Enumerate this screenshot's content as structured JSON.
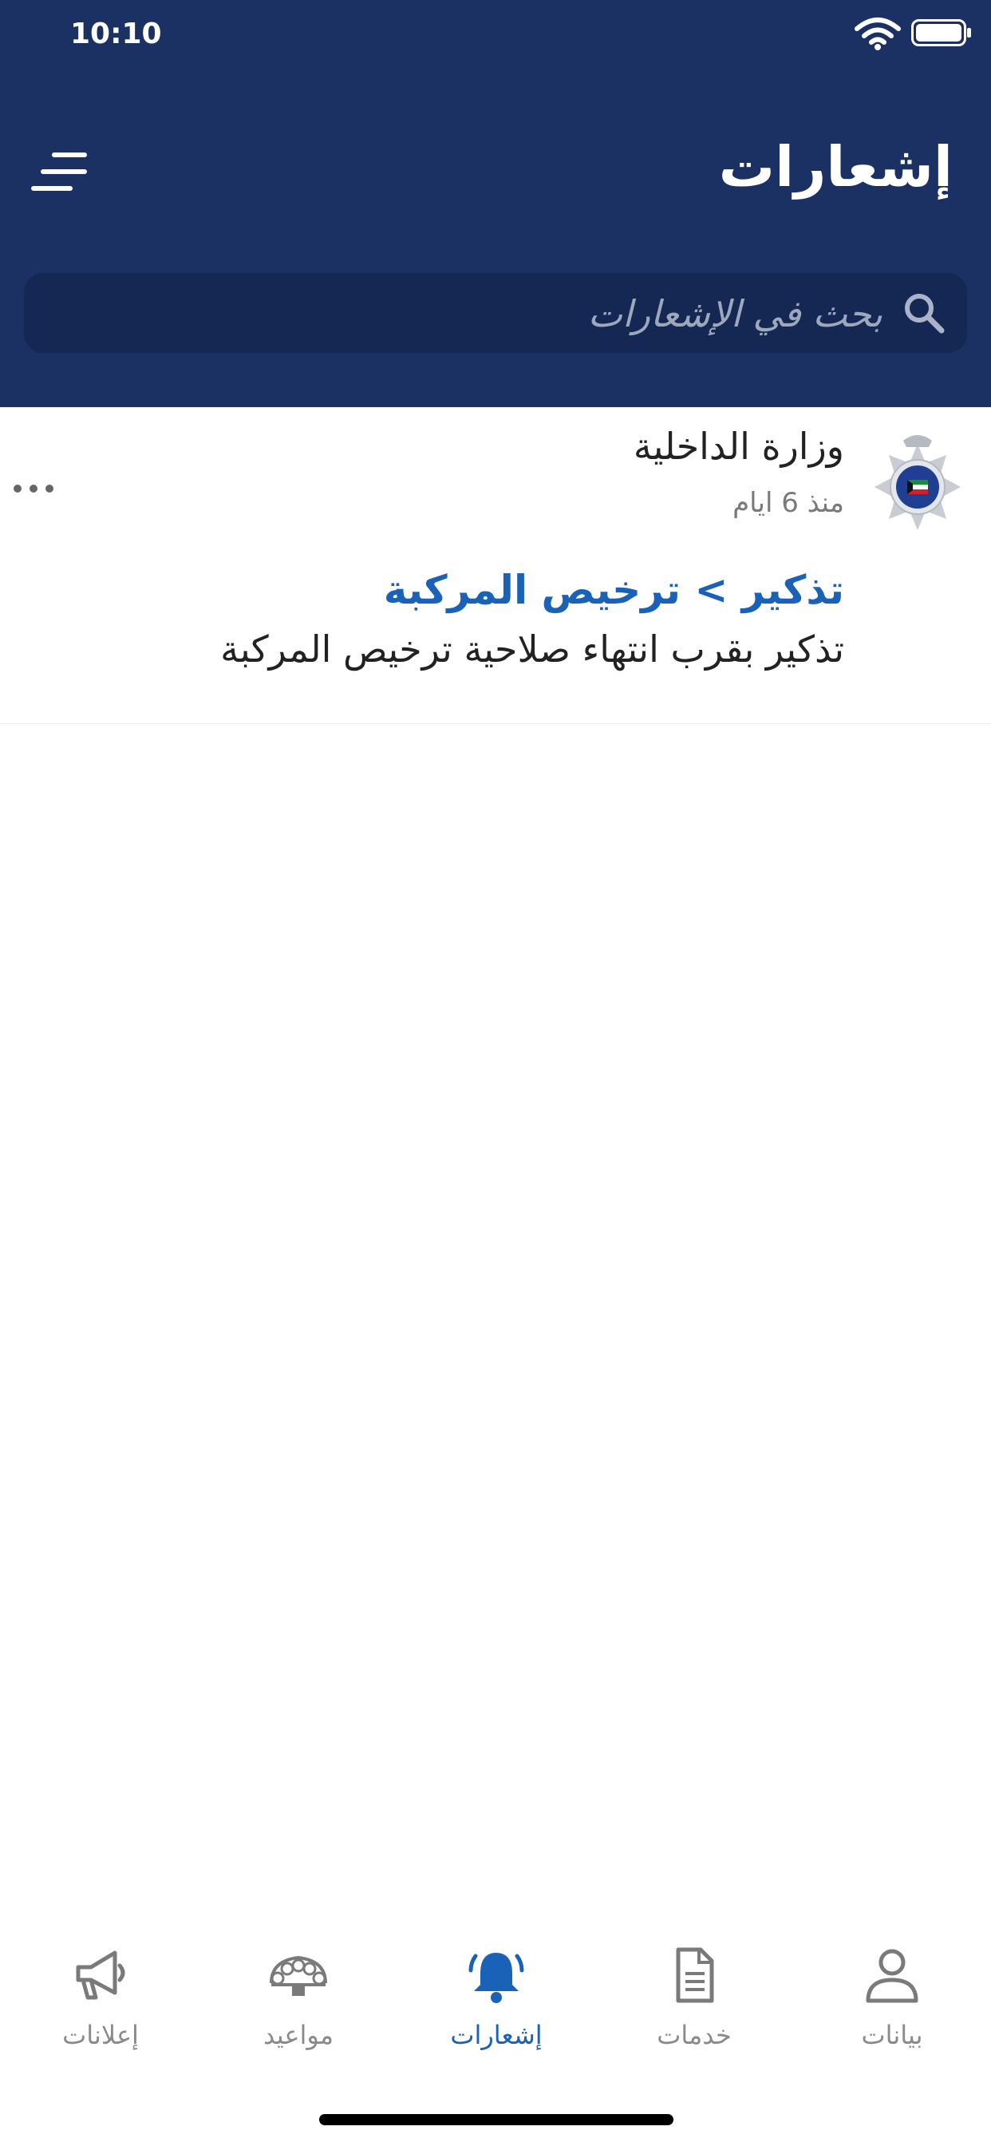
{
  "status_bar": {
    "time": "10:10"
  },
  "header": {
    "title": "إشعارات"
  },
  "search": {
    "placeholder": "بحث في الإشعارات"
  },
  "notification": {
    "sender": "وزارة الداخلية",
    "time_ago": "منذ 6 ايام",
    "title": "تذكير > ترخيص المركبة",
    "body": "تذكير بقرب انتهاء صلاحية ترخيص المركبة",
    "logo_icon": "kuwait-police-logo"
  },
  "tabbar": {
    "items": [
      {
        "label": "بيانات",
        "icon": "person-icon",
        "active": false
      },
      {
        "label": "خدمات",
        "icon": "document-icon",
        "active": false
      },
      {
        "label": "إشعارات",
        "icon": "bell-icon",
        "active": true
      },
      {
        "label": "مواعيد",
        "icon": "appointments-icon",
        "active": false
      },
      {
        "label": "إعلانات",
        "icon": "megaphone-icon",
        "active": false
      }
    ]
  },
  "colors": {
    "header_bg": "#1b3163",
    "search_bg": "#152853",
    "accent": "#1a62b8",
    "inactive": "#8a8a8a"
  }
}
